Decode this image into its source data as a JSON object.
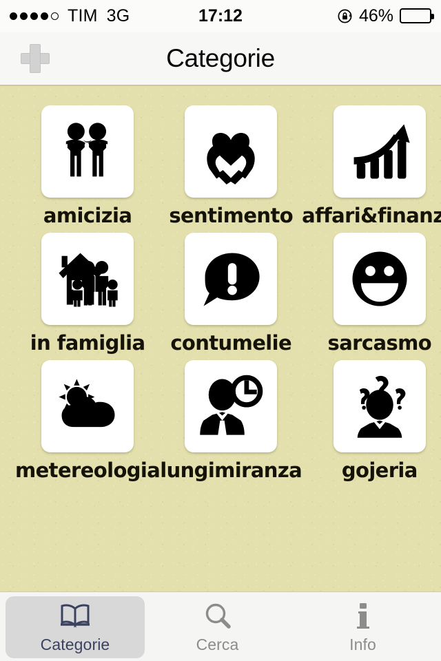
{
  "status_bar": {
    "signal_dots_filled": 4,
    "signal_dots_total": 5,
    "carrier": "TIM",
    "network": "3G",
    "time": "17:12",
    "battery_percent_label": "46%",
    "battery_level": 46,
    "rotation_lock_icon": "rotation-lock-icon"
  },
  "nav_bar": {
    "title": "Categorie",
    "add_button_icon": "plus-icon"
  },
  "categories": [
    {
      "label": "amicizia",
      "icon": "two-friends-icon"
    },
    {
      "label": "sentimento",
      "icon": "hands-holding-heart-icon"
    },
    {
      "label": "affari&finanza",
      "icon": "growth-chart-arrow-icon"
    },
    {
      "label": "in famiglia",
      "icon": "house-family-icon"
    },
    {
      "label": "contumelie",
      "icon": "speech-bubble-exclamation-icon"
    },
    {
      "label": "sarcasmo",
      "icon": "smiley-face-icon"
    },
    {
      "label": "metereologia",
      "icon": "sun-cloud-icon"
    },
    {
      "label": "lungimiranza",
      "icon": "businessman-clock-icon"
    },
    {
      "label": "gojeria",
      "icon": "person-question-marks-icon"
    }
  ],
  "tab_bar": {
    "tabs": [
      {
        "label": "Categorie",
        "icon": "open-book-icon",
        "active": true
      },
      {
        "label": "Cerca",
        "icon": "search-icon",
        "active": false
      },
      {
        "label": "Info",
        "icon": "info-icon",
        "active": false
      }
    ]
  },
  "colors": {
    "background": "#e3e0ad",
    "tile": "#ffffff",
    "icon": "#000000",
    "nav_background": "#f7f7f5",
    "tab_active_text": "#3b4260",
    "tab_inactive_text": "#8c8c8c",
    "tab_active_pill": "#d8d8d8",
    "separator": "#cfc893"
  }
}
